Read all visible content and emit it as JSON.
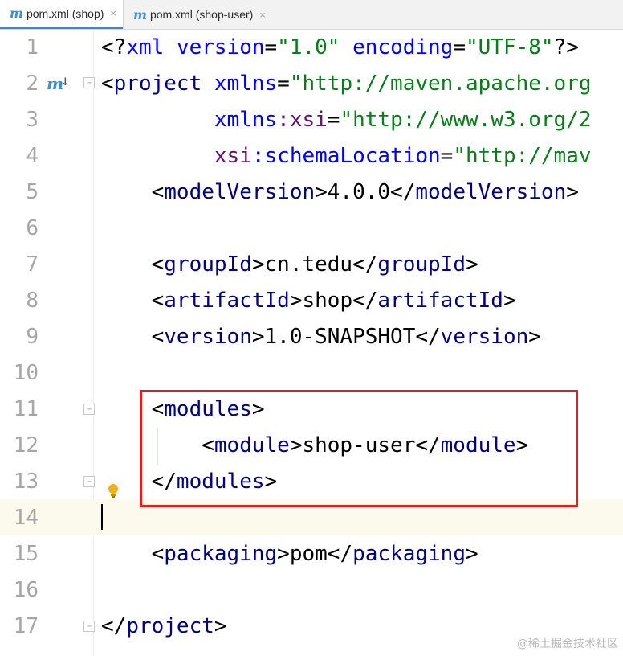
{
  "tabs": [
    {
      "icon": "m",
      "label": "pom.xml (shop)",
      "close": "×",
      "active": true
    },
    {
      "icon": "m",
      "label": "pom.xml (shop-user)",
      "close": "×",
      "active": false
    }
  ],
  "gutter": {
    "maven_icon": "m",
    "maven_arrow": "↓",
    "fold_collapse": "−"
  },
  "lines": [
    {
      "num": "1",
      "segments": [
        {
          "c": "txt",
          "t": "<?"
        },
        {
          "c": "attr",
          "t": "xml "
        },
        {
          "c": "attr",
          "t": "version"
        },
        {
          "c": "txt",
          "t": "="
        },
        {
          "c": "val",
          "t": "\"1.0\""
        },
        {
          "c": "txt",
          "t": " "
        },
        {
          "c": "attr",
          "t": "encoding"
        },
        {
          "c": "txt",
          "t": "="
        },
        {
          "c": "val",
          "t": "\"UTF-8\""
        },
        {
          "c": "txt",
          "t": "?>"
        }
      ]
    },
    {
      "num": "2",
      "segments": [
        {
          "c": "txt",
          "t": "<"
        },
        {
          "c": "tag",
          "t": "project"
        },
        {
          "c": "txt",
          "t": " "
        },
        {
          "c": "attr",
          "t": "xmlns"
        },
        {
          "c": "txt",
          "t": "="
        },
        {
          "c": "val",
          "t": "\"http://maven.apache.org"
        }
      ]
    },
    {
      "num": "3",
      "segments": [
        {
          "c": "txt",
          "t": "         "
        },
        {
          "c": "attr",
          "t": "xmlns"
        },
        {
          "c": "ns",
          "t": ":xsi"
        },
        {
          "c": "txt",
          "t": "="
        },
        {
          "c": "val",
          "t": "\"http://www.w3.org/2"
        }
      ]
    },
    {
      "num": "4",
      "segments": [
        {
          "c": "txt",
          "t": "         "
        },
        {
          "c": "ns",
          "t": "xsi"
        },
        {
          "c": "attr",
          "t": ":schemaLocation"
        },
        {
          "c": "txt",
          "t": "="
        },
        {
          "c": "val",
          "t": "\"http://mav"
        }
      ]
    },
    {
      "num": "5",
      "segments": [
        {
          "c": "txt",
          "t": "    <"
        },
        {
          "c": "tag",
          "t": "modelVersion"
        },
        {
          "c": "txt",
          "t": ">4.0.0</"
        },
        {
          "c": "tag",
          "t": "modelVersion"
        },
        {
          "c": "txt",
          "t": ">"
        }
      ]
    },
    {
      "num": "6",
      "segments": []
    },
    {
      "num": "7",
      "segments": [
        {
          "c": "txt",
          "t": "    <"
        },
        {
          "c": "tag",
          "t": "groupId"
        },
        {
          "c": "txt",
          "t": ">cn.tedu</"
        },
        {
          "c": "tag",
          "t": "groupId"
        },
        {
          "c": "txt",
          "t": ">"
        }
      ]
    },
    {
      "num": "8",
      "segments": [
        {
          "c": "txt",
          "t": "    <"
        },
        {
          "c": "tag",
          "t": "artifactId"
        },
        {
          "c": "txt",
          "t": ">shop</"
        },
        {
          "c": "tag",
          "t": "artifactId"
        },
        {
          "c": "txt",
          "t": ">"
        }
      ]
    },
    {
      "num": "9",
      "segments": [
        {
          "c": "txt",
          "t": "    <"
        },
        {
          "c": "tag",
          "t": "version"
        },
        {
          "c": "txt",
          "t": ">1.0-SNAPSHOT</"
        },
        {
          "c": "tag",
          "t": "version"
        },
        {
          "c": "txt",
          "t": ">"
        }
      ]
    },
    {
      "num": "10",
      "segments": []
    },
    {
      "num": "11",
      "segments": [
        {
          "c": "txt",
          "t": "    <"
        },
        {
          "c": "tag",
          "t": "modules"
        },
        {
          "c": "txt",
          "t": ">"
        }
      ]
    },
    {
      "num": "12",
      "segments": [
        {
          "c": "txt",
          "t": "        <"
        },
        {
          "c": "tag",
          "t": "module"
        },
        {
          "c": "txt",
          "t": ">shop-user</"
        },
        {
          "c": "tag",
          "t": "module"
        },
        {
          "c": "txt",
          "t": ">"
        }
      ]
    },
    {
      "num": "13",
      "segments": [
        {
          "c": "txt",
          "t": "    </"
        },
        {
          "c": "tag",
          "t": "modules"
        },
        {
          "c": "txt",
          "t": ">"
        }
      ]
    },
    {
      "num": "14",
      "segments": []
    },
    {
      "num": "15",
      "segments": [
        {
          "c": "txt",
          "t": "    <"
        },
        {
          "c": "tag",
          "t": "packaging"
        },
        {
          "c": "txt",
          "t": ">pom</"
        },
        {
          "c": "tag",
          "t": "packaging"
        },
        {
          "c": "txt",
          "t": ">"
        }
      ]
    },
    {
      "num": "16",
      "segments": []
    },
    {
      "num": "17",
      "segments": [
        {
          "c": "txt",
          "t": "</"
        },
        {
          "c": "tag",
          "t": "project"
        },
        {
          "c": "txt",
          "t": ">"
        }
      ]
    }
  ],
  "watermark": "@稀土掘金技术社区",
  "colors": {
    "tag": "#000080",
    "attribute": "#0000ff",
    "namespace": "#660e7a",
    "string": "#067d17",
    "highlight_box": "#d92020",
    "current_line": "#fcfaed",
    "line_number": "#a6a6a6"
  }
}
